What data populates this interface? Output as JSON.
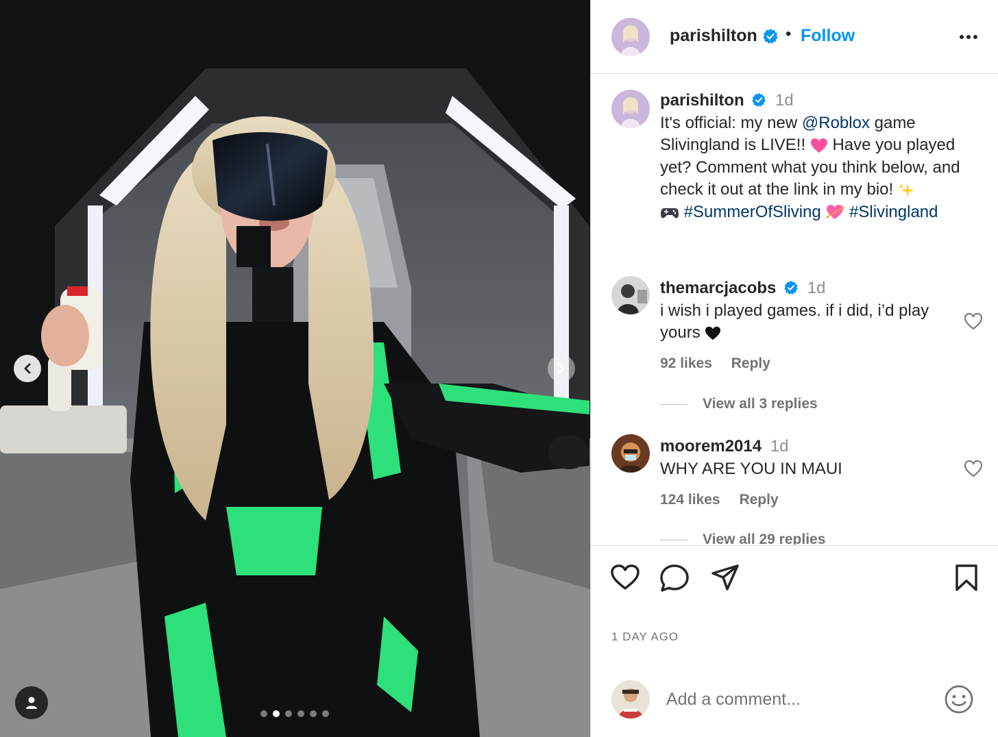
{
  "post": {
    "username": "parishilton",
    "follow_label": "Follow",
    "separator": "•",
    "carousel": {
      "total_slides": 6,
      "active_slide": 2
    }
  },
  "caption": {
    "username": "parishilton",
    "time": "1d",
    "text_1": "It's official: my new ",
    "mention": "@Roblox",
    "text_2": " game Slivingland is LIVE!! ",
    "emoji_heart": "pink-heart",
    "text_3": " Have you played yet? Comment what you think below, and check it out at the link in my bio! ",
    "emoji_sparkles": "sparkles",
    "emoji_controller": "game-controller",
    "hashtag_1": "#SummerOfSliving",
    "emoji_heart_arrow": "heart-with-arrow",
    "hashtag_2": "#Slivingland"
  },
  "comments": [
    {
      "username": "themarcjacobs",
      "verified": true,
      "time": "1d",
      "text": "i wish i played games. if i did, i’d play yours ",
      "emoji": "black-heart",
      "likes": "92 likes",
      "reply_label": "Reply",
      "view_replies": "View all 3 replies"
    },
    {
      "username": "moorem2014",
      "verified": false,
      "time": "1d",
      "text": "WHY ARE YOU IN MAUI",
      "likes": "124 likes",
      "reply_label": "Reply",
      "view_replies": "View all 29 replies"
    }
  ],
  "timestamp": "1 DAY AGO",
  "add_comment": {
    "placeholder": "Add a comment..."
  },
  "colors": {
    "link_blue": "#0095f6",
    "hashtag_navy": "#00376b",
    "verified_blue": "#0095f6",
    "secondary_text": "#737373",
    "suit_green": "#2ee07a"
  },
  "icons": [
    "verified-badge-icon",
    "more-options-icon",
    "like-icon",
    "comment-icon",
    "share-icon",
    "save-icon",
    "emoji-picker-icon",
    "user-tag-icon",
    "chevron-left-icon",
    "chevron-right-icon"
  ]
}
